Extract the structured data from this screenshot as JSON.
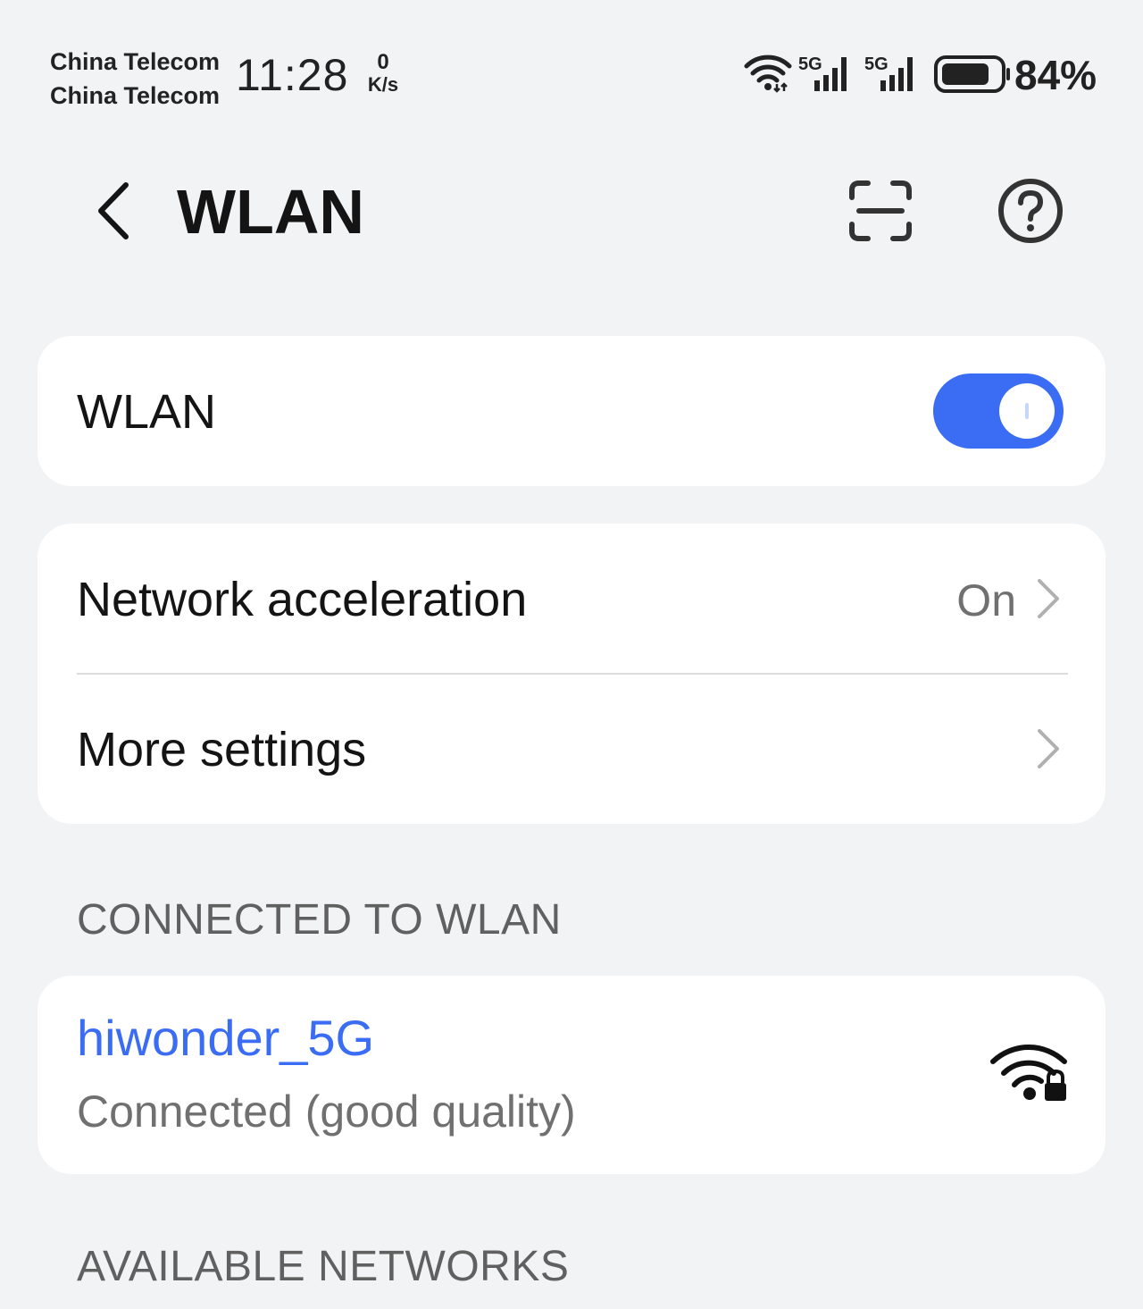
{
  "status_bar": {
    "carrier_1": "China Telecom",
    "carrier_2": "China Telecom",
    "time": "11:28",
    "net_speed_value": "0",
    "net_speed_unit": "K/s",
    "signal_1_label": "5G",
    "signal_2_label": "5G",
    "battery_percent": "84%",
    "battery_level": 0.84,
    "icons": [
      "wifi-icon",
      "signal-5g-icon",
      "signal-5g-icon",
      "battery-icon"
    ]
  },
  "header": {
    "title": "WLAN",
    "back_icon": "chevron-left-icon",
    "actions": [
      "scan-icon",
      "help-icon"
    ]
  },
  "wlan_card": {
    "label": "WLAN",
    "toggle_on": true
  },
  "settings_card": {
    "network_acceleration": {
      "label": "Network acceleration",
      "value": "On"
    },
    "more_settings": {
      "label": "More settings"
    }
  },
  "connected_section": {
    "header": "CONNECTED TO WLAN",
    "network": {
      "ssid": "hiwonder_5G",
      "status": "Connected (good quality)",
      "icon": "wifi-lock-icon"
    }
  },
  "available_section": {
    "header": "AVAILABLE NETWORKS"
  },
  "colors": {
    "accent": "#3a6cf4",
    "background": "#f1f3f5",
    "card": "#ffffff",
    "secondary_text": "#707070"
  }
}
